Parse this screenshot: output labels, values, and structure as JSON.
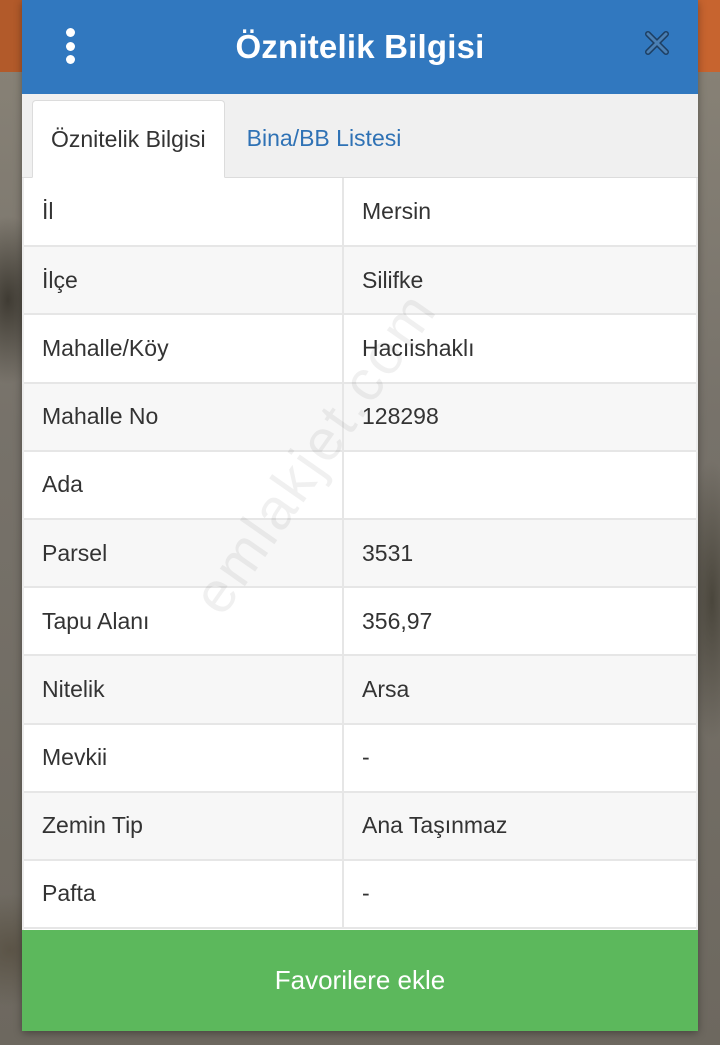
{
  "header": {
    "title": "Öznitelik Bilgisi",
    "menu_icon": "more-vertical-icon",
    "close_icon": "close-icon",
    "color": "#3178bf"
  },
  "tabs": [
    {
      "label": "Öznitelik Bilgisi",
      "active": true
    },
    {
      "label": "Bina/BB Listesi",
      "active": false
    }
  ],
  "attributes": [
    {
      "key": "İl",
      "value": "Mersin"
    },
    {
      "key": "İlçe",
      "value": "Silifke"
    },
    {
      "key": "Mahalle/Köy",
      "value": "Hacıishaklı"
    },
    {
      "key": "Mahalle No",
      "value": "128298"
    },
    {
      "key": "Ada",
      "value": ""
    },
    {
      "key": "Parsel",
      "value": "3531"
    },
    {
      "key": "Tapu Alanı",
      "value": "356,97"
    },
    {
      "key": "Nitelik",
      "value": "Arsa"
    },
    {
      "key": "Mevkii",
      "value": "-"
    },
    {
      "key": "Zemin Tip",
      "value": "Ana Taşınmaz"
    },
    {
      "key": "Pafta",
      "value": "-"
    }
  ],
  "watermark": "emlakjet.com",
  "footer": {
    "favorite_label": "Favorilere ekle",
    "color": "#5cb85c"
  }
}
